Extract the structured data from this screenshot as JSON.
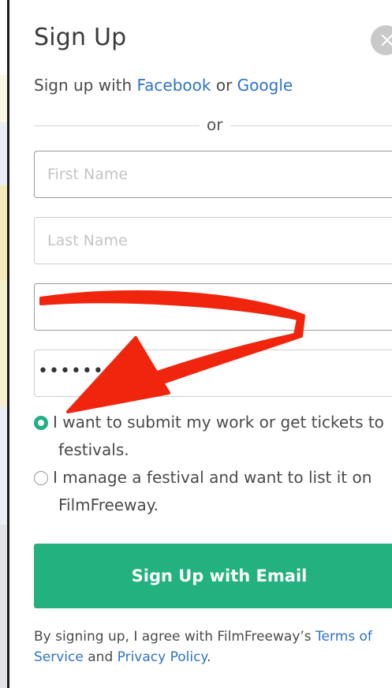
{
  "modal": {
    "title": "Sign Up",
    "close_label": "×"
  },
  "social": {
    "prefix": "Sign up with ",
    "facebook_label": "Facebook",
    "conjunction": " or ",
    "google_label": "Google"
  },
  "divider": {
    "label": "or"
  },
  "form": {
    "first_name": {
      "value": "",
      "placeholder": "First Name"
    },
    "last_name": {
      "value": "",
      "placeholder": "Last Name"
    },
    "email": {
      "value": "",
      "placeholder": ""
    },
    "password": {
      "masked_value": "•••••••••"
    }
  },
  "role_options": [
    {
      "line1": "I want to submit my work or get tickets to",
      "line2": "festivals.",
      "selected": true
    },
    {
      "line1": "I manage a festival and want to list it on",
      "line2": "FilmFreeway.",
      "selected": false
    }
  ],
  "submit": {
    "label": "Sign Up with Email"
  },
  "terms": {
    "prefix": "By signing up, I agree with FilmFreeway’s ",
    "terms_label": "Terms of Service",
    "middle": " and ",
    "privacy_label": "Privacy Policy",
    "suffix": "."
  },
  "colors": {
    "accent_green": "#22b17f",
    "link_blue": "#2e73c6",
    "annotation_red": "#f0250d"
  },
  "annotation": {
    "type": "arrow",
    "color": "#f0250d",
    "icon": "red-arrow-annotation"
  }
}
